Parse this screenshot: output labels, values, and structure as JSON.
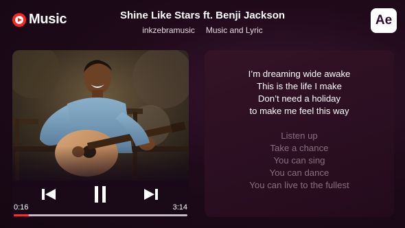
{
  "brand": {
    "name": "Music",
    "icon": "play-circle-icon",
    "accent": "#ff2222"
  },
  "header": {
    "title": "Shine Like Stars ft. Benji Jackson",
    "artist": "inkzebramusic",
    "category": "Music and Lyric"
  },
  "badge": {
    "label": "Ae"
  },
  "player": {
    "current_time": "0:16",
    "total_time": "3:14",
    "progress": 0.085,
    "controls": {
      "previous": "skip-previous-icon",
      "play_pause": "pause-icon",
      "next": "skip-next-icon"
    },
    "photo": "man-playing-guitar-photo"
  },
  "lyrics": {
    "active": [
      "I’m dreaming wide awake",
      "This is the life I make",
      "Don’t need a holiday",
      "to make me feel this way"
    ],
    "upcoming": [
      "Listen up",
      "Take a chance",
      "You can sing",
      "You can dance",
      "You can live to the fullest"
    ]
  }
}
